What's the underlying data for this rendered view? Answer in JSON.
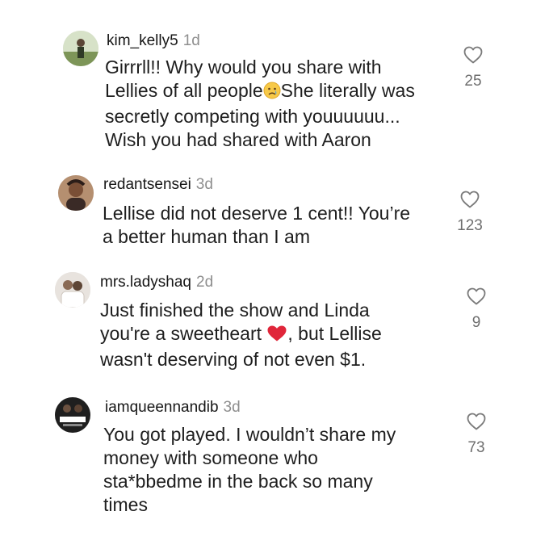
{
  "comments": [
    {
      "username": "kim_kelly5",
      "time": "1d",
      "text_parts": [
        "Girrrll!! Why would you share with\nLellies of all people",
        "She literally was\nsecretly competing with youuuuuu...\nWish you had shared with Aaron"
      ],
      "emoji": "crying-face",
      "likes": "25",
      "avatar_colors": [
        "#c9d7b8",
        "#5a6b3f",
        "#e8e1d4"
      ]
    },
    {
      "username": "redantsensei",
      "time": "3d",
      "text": "Lellise did not deserve 1 cent!! You’re\na better human than I am",
      "likes": "123",
      "avatar_colors": [
        "#6a4c3b",
        "#c7a17e",
        "#3b2b29"
      ]
    },
    {
      "username": "mrs.ladyshaq",
      "time": "2d",
      "text_parts": [
        "Just finished the show and Linda\nyou're a sweetheart ",
        ", but Lellise\nwasn't deserving of not even $1."
      ],
      "emoji": "red-heart",
      "likes": "9",
      "avatar_colors": [
        "#e7e2dc",
        "#9a8f86",
        "#ffffff"
      ]
    },
    {
      "username": "iamqueennandib",
      "time": "3d",
      "text": "You got played. I wouldn’t share my\nmoney with someone who\nsta*bbedme in the back so many\ntimes",
      "likes": "73",
      "avatar_colors": [
        "#1e1e1e",
        "#ffffff",
        "#444444"
      ]
    }
  ]
}
